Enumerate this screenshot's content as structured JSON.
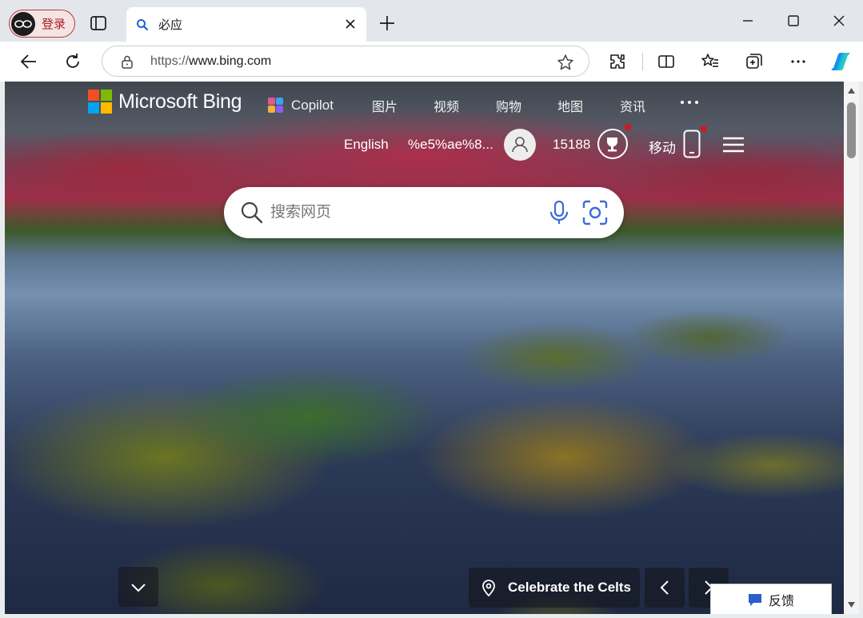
{
  "browser": {
    "profile_label": "登录",
    "tab_title": "必应",
    "url_scheme": "https://",
    "url_host": "www.bing.com"
  },
  "bing": {
    "brand": "Microsoft Bing",
    "nav": {
      "copilot": "Copilot",
      "images": "图片",
      "videos": "视频",
      "shopping": "购物",
      "maps": "地图",
      "news": "资讯"
    },
    "language": "English",
    "username": "%e5%ae%8...",
    "points": "15188",
    "mobile": "移动",
    "search_placeholder": "搜索网页",
    "caption": "Celebrate the Celts",
    "feedback": "反馈"
  },
  "colors": {
    "ms_red": "#f25022",
    "ms_green": "#7fba00",
    "ms_blue": "#00a4ef",
    "ms_yellow": "#ffb900",
    "search_icon_blue": "#3a6bd8",
    "notification_red": "#d6161f"
  }
}
